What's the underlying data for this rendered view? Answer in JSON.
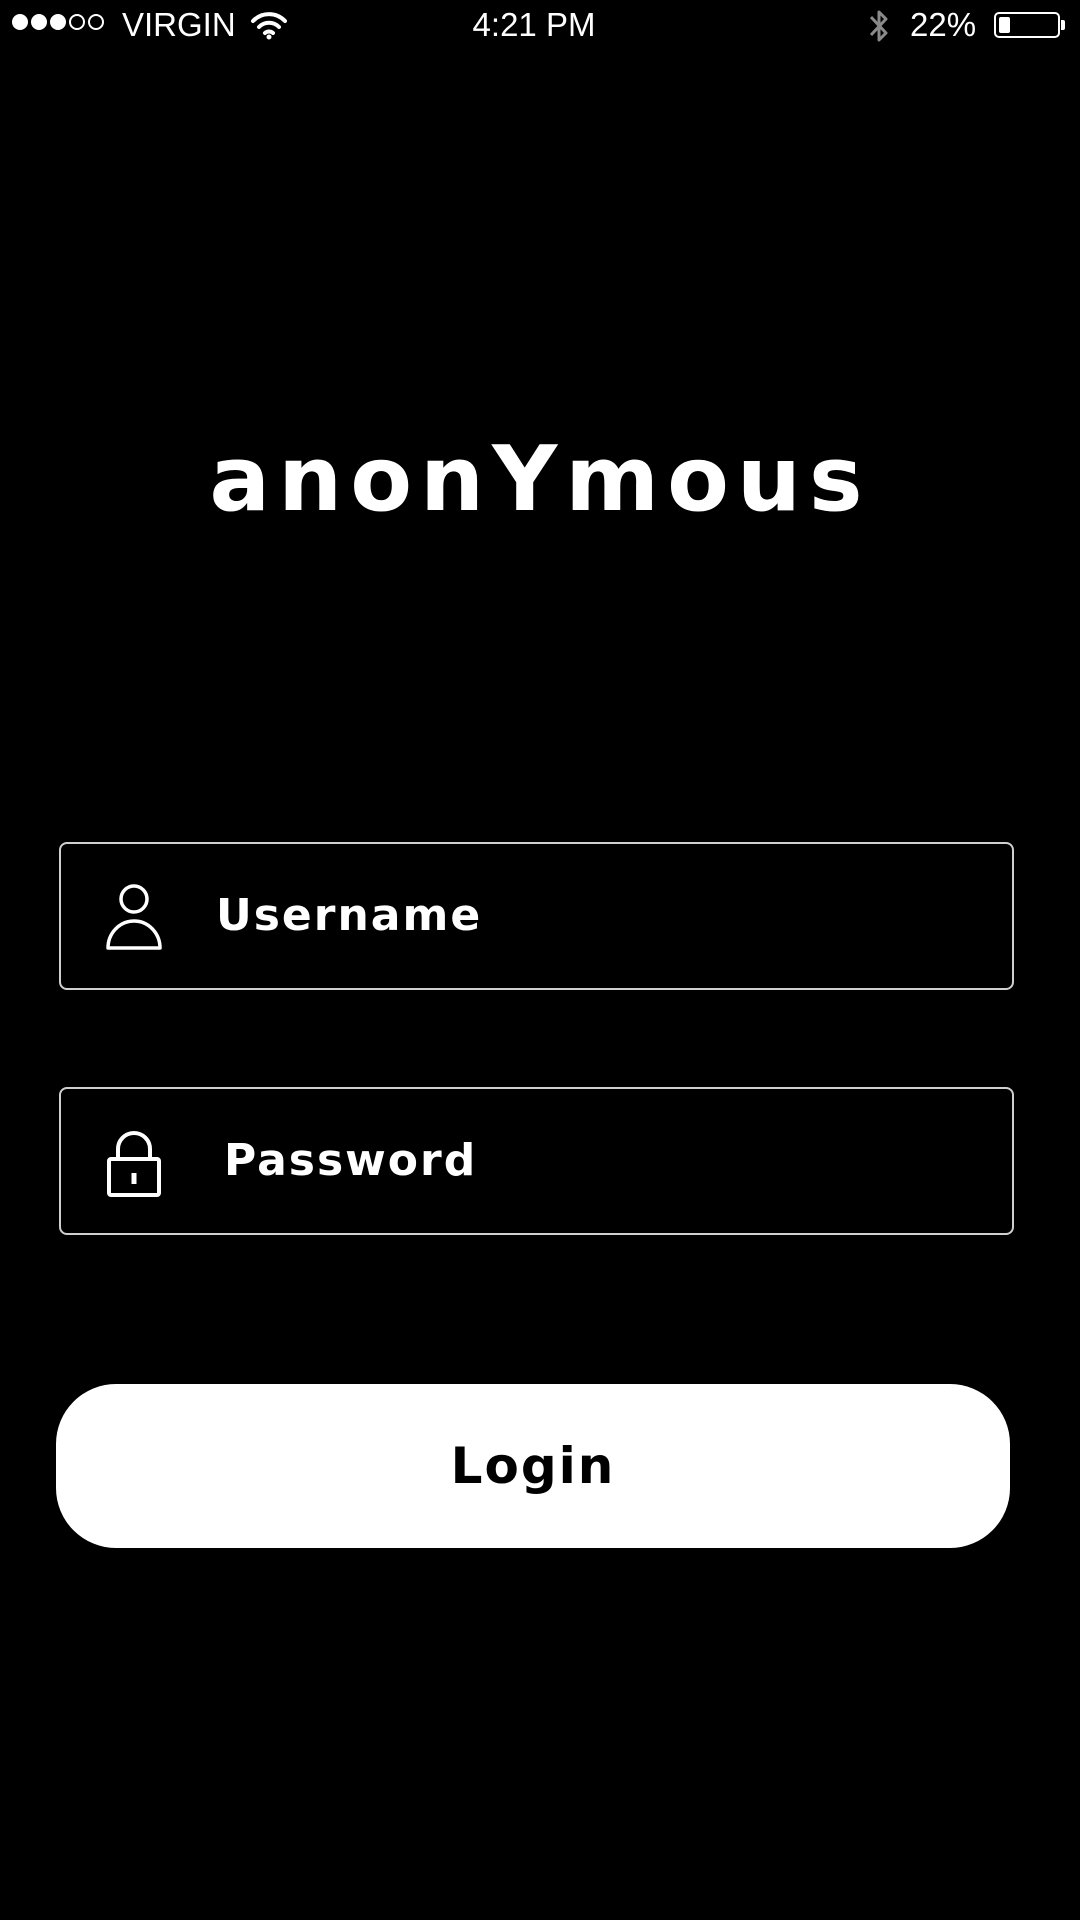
{
  "status_bar": {
    "signal_filled": 3,
    "signal_total": 5,
    "carrier": "VIRGIN",
    "time": "4:21 PM",
    "battery_percent_label": "22%",
    "battery_level": 0.22,
    "icons": [
      "wifi-icon",
      "bluetooth-icon",
      "battery-icon"
    ]
  },
  "app": {
    "logo_text": "anonYmous"
  },
  "form": {
    "username_placeholder": "Username",
    "password_placeholder": "Password",
    "username_icon": "user-icon",
    "password_icon": "lock-icon",
    "login_label": "Login"
  },
  "colors": {
    "background": "#000000",
    "foreground": "#ffffff",
    "field_border": "#cfcfcf"
  }
}
